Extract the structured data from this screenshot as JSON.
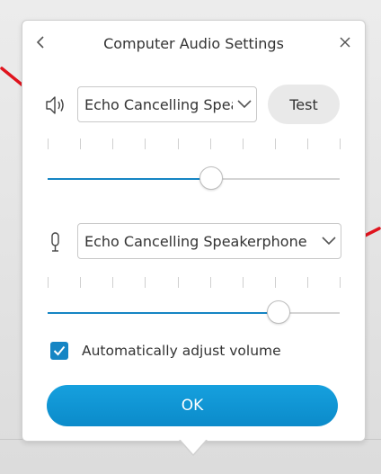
{
  "dialog": {
    "title": "Computer Audio Settings",
    "back_icon": "chevron-left-icon",
    "close_icon": "close-icon"
  },
  "speaker": {
    "icon": "speaker-icon",
    "selected_device": "Echo Cancelling Speakerphone",
    "test_label": "Test",
    "volume_percent": 56
  },
  "microphone": {
    "icon": "microphone-icon",
    "selected_device": "Echo Cancelling Speakerphone",
    "volume_percent": 79
  },
  "auto_adjust": {
    "label": "Automatically adjust volume",
    "checked": true
  },
  "ok_label": "OK",
  "colors": {
    "accent": "#1585c4",
    "ok_button": "#0f97d6",
    "annotation_arrow": "#e0141e"
  }
}
